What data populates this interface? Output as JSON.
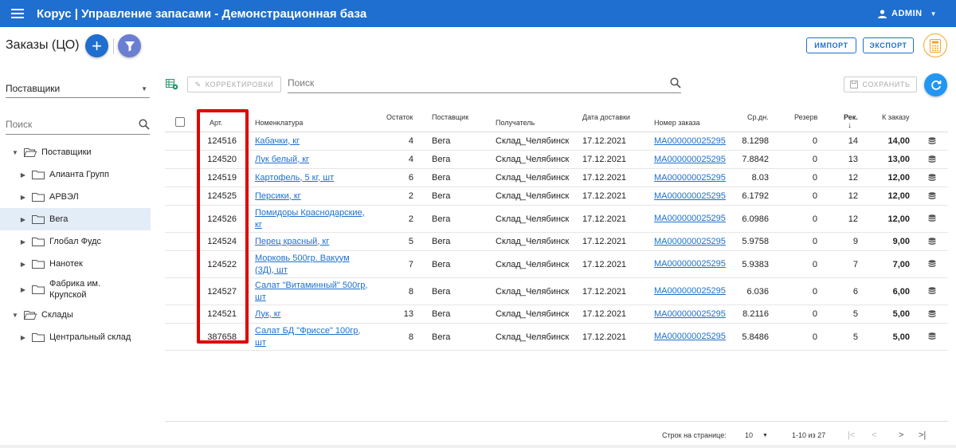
{
  "app": {
    "title": "Корус | Управление запасами - Демонстрационная база",
    "user": "ADMIN",
    "colors": {
      "primary": "#1e6fcf",
      "filter_fab": "#6b7fd2",
      "refresh": "#2196f3",
      "calc": "#f5a623",
      "highlight": "#e00000"
    }
  },
  "page": {
    "title": "Заказы (ЦО)"
  },
  "header_buttons": {
    "import": "ИМПОРТ",
    "export": "ЭКСПОРТ"
  },
  "sidebar": {
    "select_value": "Поставщики",
    "search_placeholder": "Поиск",
    "tree": [
      {
        "label": "Поставщики",
        "level": 0,
        "expanded": true,
        "open_folder": true
      },
      {
        "label": "Алианта Групп",
        "level": 1
      },
      {
        "label": "АРВЭЛ",
        "level": 1
      },
      {
        "label": "Вега",
        "level": 1,
        "selected": true
      },
      {
        "label": "Глобал Фудс",
        "level": 1
      },
      {
        "label": "Нанотек",
        "level": 1
      },
      {
        "label": "Фабрика им. Крупской",
        "level": 1,
        "tall": true
      },
      {
        "label": "Склады",
        "level": 0,
        "expanded": true,
        "open_folder": true
      },
      {
        "label": "Центральный склад",
        "level": 1
      }
    ]
  },
  "toolbar": {
    "corrections": "КОРРЕКТИРОВКИ",
    "search_placeholder": "Поиск",
    "save": "СОХРАНИТЬ"
  },
  "table": {
    "columns": {
      "art": "Арт.",
      "nomen": "Номенклатура",
      "stock": "Остаток",
      "supplier": "Поставщик",
      "recipient": "Получатель",
      "date": "Дата доставки",
      "order": "Номер заказа",
      "avg": "Ср.дн.",
      "reserve": "Резерв",
      "rec": "Рек.",
      "to_order": "К заказу"
    },
    "rows": [
      {
        "art": "124516",
        "nomen": "Кабачки, кг",
        "stock": "4",
        "supplier": "Вега",
        "recipient": "Склад_Челябинск",
        "date": "17.12.2021",
        "order": "МА000000025295",
        "avg": "8.1298",
        "reserve": "0",
        "rec": "14",
        "to_order": "14,00"
      },
      {
        "art": "124520",
        "nomen": "Лук белый, кг",
        "stock": "4",
        "supplier": "Вега",
        "recipient": "Склад_Челябинск",
        "date": "17.12.2021",
        "order": "МА000000025295",
        "avg": "7.8842",
        "reserve": "0",
        "rec": "13",
        "to_order": "13,00"
      },
      {
        "art": "124519",
        "nomen": "Картофель, 5 кг, шт",
        "stock": "6",
        "supplier": "Вега",
        "recipient": "Склад_Челябинск",
        "date": "17.12.2021",
        "order": "МА000000025295",
        "avg": "8.03",
        "reserve": "0",
        "rec": "12",
        "to_order": "12,00"
      },
      {
        "art": "124525",
        "nomen": "Персики, кг",
        "stock": "2",
        "supplier": "Вега",
        "recipient": "Склад_Челябинск",
        "date": "17.12.2021",
        "order": "МА000000025295",
        "avg": "6.1792",
        "reserve": "0",
        "rec": "12",
        "to_order": "12,00"
      },
      {
        "art": "124526",
        "nomen": "Помидоры Краснодарские, кг",
        "stock": "2",
        "supplier": "Вега",
        "recipient": "Склад_Челябинск",
        "date": "17.12.2021",
        "order": "МА000000025295",
        "avg": "6.0986",
        "reserve": "0",
        "rec": "12",
        "to_order": "12,00"
      },
      {
        "art": "124524",
        "nomen": "Перец красный, кг",
        "stock": "5",
        "supplier": "Вега",
        "recipient": "Склад_Челябинск",
        "date": "17.12.2021",
        "order": "МА000000025295",
        "avg": "5.9758",
        "reserve": "0",
        "rec": "9",
        "to_order": "9,00"
      },
      {
        "art": "124522",
        "nomen": "Морковь 500гр. Вакуум (3Д), шт",
        "stock": "7",
        "supplier": "Вега",
        "recipient": "Склад_Челябинск",
        "date": "17.12.2021",
        "order": "МА000000025295",
        "avg": "5.9383",
        "reserve": "0",
        "rec": "7",
        "to_order": "7,00"
      },
      {
        "art": "124527",
        "nomen": "Салат \"Витаминный\" 500гр, шт",
        "stock": "8",
        "supplier": "Вега",
        "recipient": "Склад_Челябинск",
        "date": "17.12.2021",
        "order": "МА000000025295",
        "avg": "6.036",
        "reserve": "0",
        "rec": "6",
        "to_order": "6,00"
      },
      {
        "art": "124521",
        "nomen": "Лук, кг",
        "stock": "13",
        "supplier": "Вега",
        "recipient": "Склад_Челябинск",
        "date": "17.12.2021",
        "order": "МА000000025295",
        "avg": "8.2116",
        "reserve": "0",
        "rec": "5",
        "to_order": "5,00"
      },
      {
        "art": "387658",
        "nomen": "Салат БД \"Фриссе\" 100гр, шт",
        "stock": "8",
        "supplier": "Вега",
        "recipient": "Склад_Челябинск",
        "date": "17.12.2021",
        "order": "МА000000025295",
        "avg": "5.8486",
        "reserve": "0",
        "rec": "5",
        "to_order": "5,00"
      }
    ]
  },
  "pagination": {
    "rows_per_page_label": "Строк на странице:",
    "rows_per_page": "10",
    "range": "1-10 из 27"
  }
}
